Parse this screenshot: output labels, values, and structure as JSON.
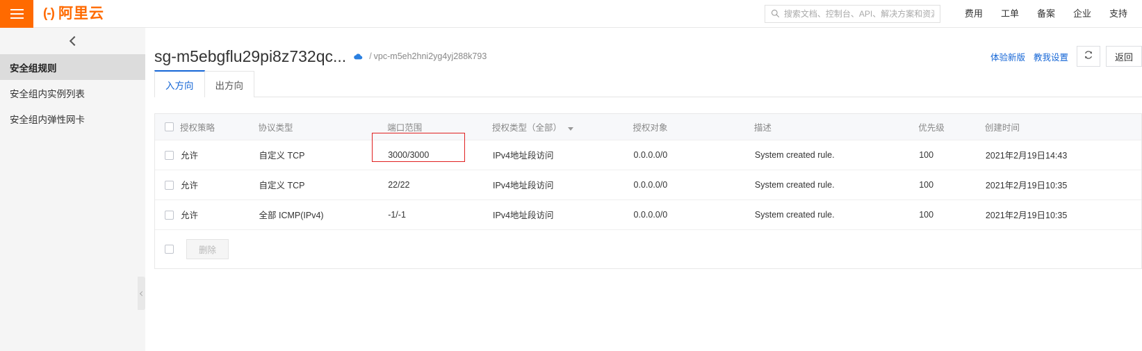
{
  "header": {
    "hamburger_icon": "hamburger-icon",
    "logo_mark": "(-)",
    "logo_text": "阿里云",
    "search": {
      "icon": "search-icon",
      "placeholder": "搜索文档、控制台、API、解决方案和资源",
      "value": ""
    },
    "nav": [
      {
        "label": "费用"
      },
      {
        "label": "工单"
      },
      {
        "label": "备案"
      },
      {
        "label": "企业"
      },
      {
        "label": "支持"
      }
    ]
  },
  "sidebar": {
    "collapse_icon": "chevron-left-icon",
    "handle_icon": "chevron-left-icon",
    "items": [
      {
        "label": "安全组规则",
        "active": true
      },
      {
        "label": "安全组内实例列表",
        "active": false
      },
      {
        "label": "安全组内弹性网卡",
        "active": false
      }
    ]
  },
  "page": {
    "title": "sg-m5ebgflu29pi8z732qc...",
    "cloud_icon": "cloud-icon",
    "breadcrumb_separator": "/",
    "vpc_id": "vpc-m5eh2hni2yg4yj288k793",
    "actions": {
      "new_version_link": "体验新版",
      "teach_settings_link": "教我设置",
      "refresh_icon": "refresh-icon",
      "back_button": "返回"
    }
  },
  "tabs": [
    {
      "label": "入方向",
      "active": true
    },
    {
      "label": "出方向",
      "active": false
    }
  ],
  "table": {
    "select_all_checkbox": false,
    "columns": [
      {
        "key": "policy",
        "label": "授权策略"
      },
      {
        "key": "protocol",
        "label": "协议类型"
      },
      {
        "key": "port",
        "label": "端口范围"
      },
      {
        "key": "auth_type",
        "label": "授权类型（全部）",
        "has_filter": true
      },
      {
        "key": "auth_object",
        "label": "授权对象"
      },
      {
        "key": "description",
        "label": "描述"
      },
      {
        "key": "priority",
        "label": "优先级"
      },
      {
        "key": "create_time",
        "label": "创建时间"
      }
    ],
    "rows": [
      {
        "policy": "允许",
        "protocol": "自定义 TCP",
        "port": "3000/3000",
        "auth_type": "IPv4地址段访问",
        "auth_object": "0.0.0.0/0",
        "description": "System created rule.",
        "priority": "100",
        "create_time": "2021年2月19日14:43",
        "highlighted": true
      },
      {
        "policy": "允许",
        "protocol": "自定义 TCP",
        "port": "22/22",
        "auth_type": "IPv4地址段访问",
        "auth_object": "0.0.0.0/0",
        "description": "System created rule.",
        "priority": "100",
        "create_time": "2021年2月19日10:35",
        "highlighted": false
      },
      {
        "policy": "允许",
        "protocol": "全部 ICMP(IPv4)",
        "port": "-1/-1",
        "auth_type": "IPv4地址段访问",
        "auth_object": "0.0.0.0/0",
        "description": "System created rule.",
        "priority": "100",
        "create_time": "2021年2月19日10:35",
        "highlighted": false
      }
    ],
    "footer": {
      "select_all_checkbox": false,
      "delete_button": "删除",
      "delete_disabled": true
    }
  },
  "colors": {
    "brand_orange": "#ff6a00",
    "link_blue": "#1566d6",
    "highlight_red": "#e02020",
    "sidebar_bg": "#f5f5f5",
    "sidebar_active_bg": "#dcdcdc",
    "table_header_bg": "#f7f8fa"
  }
}
